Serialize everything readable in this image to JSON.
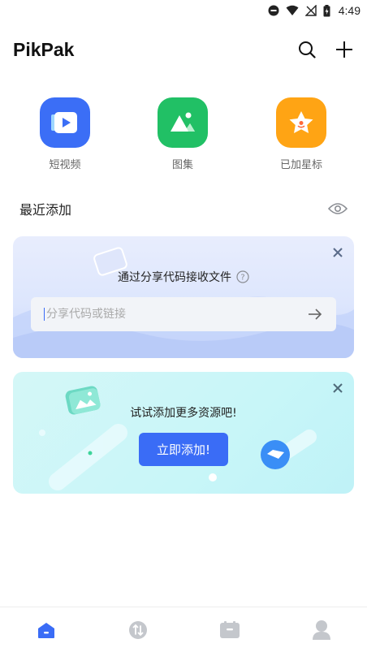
{
  "status_bar": {
    "time": "4:49"
  },
  "header": {
    "title": "PikPak"
  },
  "quick_actions": [
    {
      "label": "短视频",
      "color": "#3b6ef6"
    },
    {
      "label": "图集",
      "color": "#21c065"
    },
    {
      "label": "已加星标",
      "color": "#ffa414"
    }
  ],
  "recent": {
    "title": "最近添加"
  },
  "share_card": {
    "title": "通过分享代码接收文件",
    "input_placeholder": "分享代码或链接"
  },
  "add_card": {
    "title": "试试添加更多资源吧!",
    "button_label": "立即添加!"
  },
  "colors": {
    "accent": "#3a6cf6",
    "nav_inactive": "#c4c7cc"
  }
}
